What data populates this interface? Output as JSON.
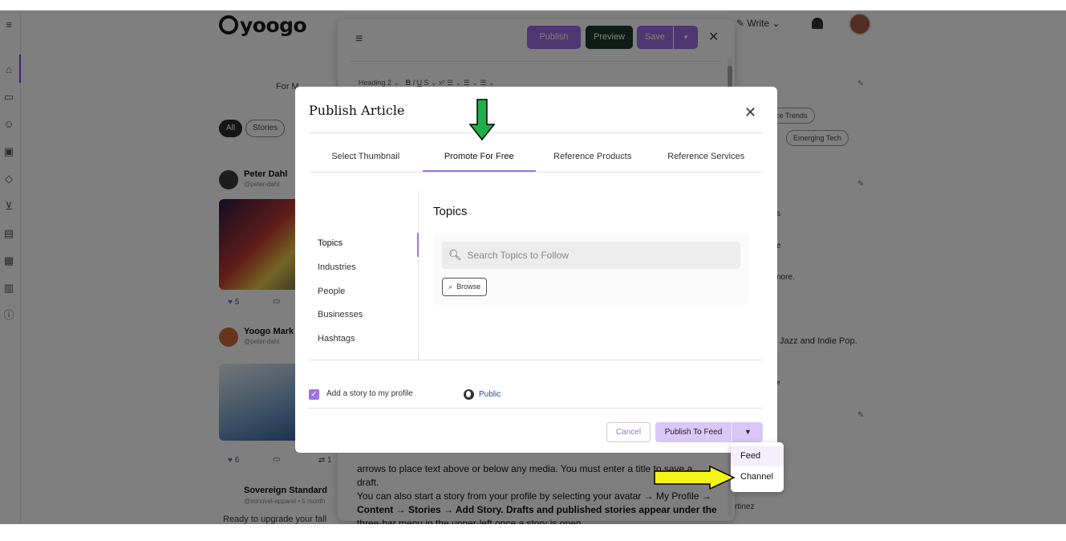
{
  "base": {
    "logo": "yoogo",
    "for_me": "For M",
    "chips": [
      "All",
      "Stories"
    ],
    "posts": [
      {
        "author": "Peter Dahl",
        "handle": "@peter-dahl",
        "likes": "5"
      },
      {
        "author": "Yoogo Mark",
        "handle": "@peter-dahl",
        "likes": "6",
        "reposts": "1"
      },
      {
        "author": "Sovereign Standard",
        "handle": "@minovel-apparel • 5 month"
      }
    ],
    "feed_preview": "Ready to upgrade your fall",
    "topbar_write": "Write",
    "right_chips": [
      "ce Trends",
      "Emerging Tech"
    ],
    "right_lines": [
      "s",
      "e",
      "nore.",
      "Jazz and Indie Pop.",
      "e",
      "rtinez"
    ]
  },
  "editor": {
    "publish": "Publish",
    "preview": "Preview",
    "save": "Save",
    "toolbar_style": "Heading 2",
    "body_lines": [
      {
        "text": "arrows to place text above or below any media. You must enter a title to save a"
      },
      {
        "text": "draft."
      },
      {
        "text": "You can also start a story from your profile by selecting your avatar → My Profile →"
      },
      {
        "text": "Content → Stories → Add Story. Drafts and published stories appear under the"
      },
      {
        "text": "three-bar menu in the upper-left once a story is open."
      }
    ]
  },
  "modal": {
    "title": "Publish Article",
    "tabs": [
      "Select Thumbnail",
      "Promote For Free",
      "Reference Products",
      "Reference Services"
    ],
    "active_tab": 1,
    "side_nav": [
      "Topics",
      "Industries",
      "People",
      "Businesses",
      "Hashtags"
    ],
    "active_side": 0,
    "content_title": "Topics",
    "search_placeholder": "Search Topics to Follow",
    "browse_label": "Browse",
    "story_label": "Add a story to my profile",
    "story_checked": true,
    "visibility": "Public",
    "cancel_label": "Cancel",
    "publish_label": "Publish To Feed"
  },
  "dropdown": {
    "items": [
      "Feed",
      "Channel"
    ]
  },
  "colors": {
    "accent": "#a071e8",
    "editor_publish": "#9a6fe0",
    "editor_preview": "#1c3b2c",
    "annotation_green": "#1fae4a",
    "annotation_yellow": "#f3f315"
  }
}
